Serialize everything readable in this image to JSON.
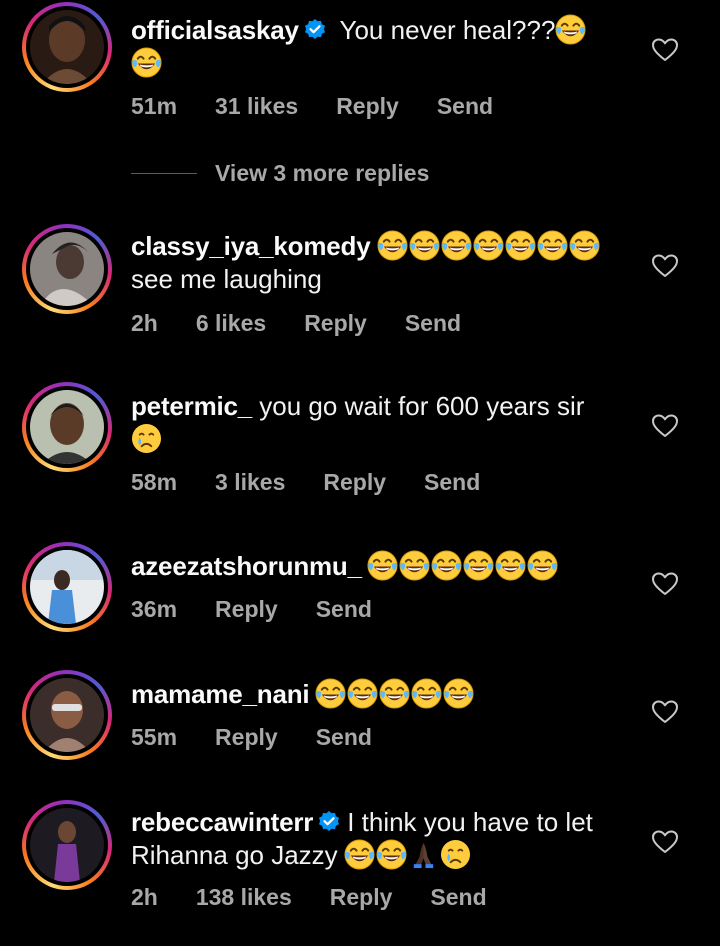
{
  "comments": [
    {
      "username": "officialsaskay",
      "verified": true,
      "text": "You never heal???",
      "time": "51m",
      "likes": "31 likes",
      "reply": "Reply",
      "send": "Send"
    },
    {
      "username": "classy_iya_komedy",
      "verified": false,
      "text": "see me laughing",
      "time": "2h",
      "likes": "6 likes",
      "reply": "Reply",
      "send": "Send"
    },
    {
      "username": "petermic_",
      "verified": false,
      "text": "you go wait for 600 years sir",
      "time": "58m",
      "likes": "3 likes",
      "reply": "Reply",
      "send": "Send"
    },
    {
      "username": "azeezatshorunmu_",
      "verified": false,
      "text": "",
      "time": "36m",
      "likes": "",
      "reply": "Reply",
      "send": "Send"
    },
    {
      "username": "mamame_nani",
      "verified": false,
      "text": "",
      "time": "55m",
      "likes": "",
      "reply": "Reply",
      "send": "Send"
    },
    {
      "username": "rebeccawinterr",
      "verified": true,
      "text": "I think you have to let Rihanna go Jazzy",
      "time": "2h",
      "likes": "138 likes",
      "reply": "Reply",
      "send": "Send"
    }
  ],
  "view_more": "View 3 more replies",
  "icons": {
    "like": "heart-outline-icon",
    "verified": "verified-badge-icon",
    "emoji_laugh": "face-with-tears-of-joy-icon",
    "emoji_cry": "crying-face-icon",
    "emoji_pray": "folded-hands-icon"
  },
  "colors": {
    "background": "#000000",
    "meta_text": "#a8a8a8",
    "verified": "#0095f6"
  }
}
